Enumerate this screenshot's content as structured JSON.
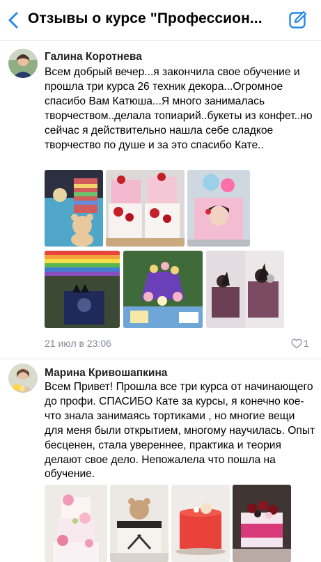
{
  "header": {
    "title": "Отзывы о курсе \"Профессион...",
    "accent_color": "#2688eb",
    "back_icon": "chevron-left-icon",
    "compose_icon": "compose-icon"
  },
  "posts": [
    {
      "author": "Галина Коротнева",
      "text": "Всем добрый вечер...я закончила свое обучение и прошла три курса 26 техник декора...Огромное спасибо Вам Катюша...Я много занималась творчеством..делала топиарий..букеты из конфет..но сейчас я действительно нашла себе сладкое творчество по душе и за это спасибо Кате..",
      "photos": [
        "cake-teddy-bear-photo",
        "cake-red-roses-photo",
        "cake-girl-portrait-photo",
        "cake-rainbow-maleficent-photo",
        "cupcake-stand-photo",
        "cake-chocolate-spheres-photo"
      ],
      "date": "21 июл в 23:06",
      "likes": "1"
    },
    {
      "author": "Марина Кривошапкина",
      "text": "Всем Привет! Прошла все три курса от начинающего до профи. СПАСИБО Кате за курсы, я конечно кое-что знала занимаясь тортиками , но многие вещи для меня были открытием, многому научилась. Опыт бесценен, стала увереннее, практика и теория делают свое дело. Непожалела что пошла на обучение.",
      "photos": [
        "cake-flowers-tiered-photo",
        "cake-bear-photo",
        "cake-red-mirror-photo",
        "cake-cherries-photo"
      ]
    }
  ]
}
